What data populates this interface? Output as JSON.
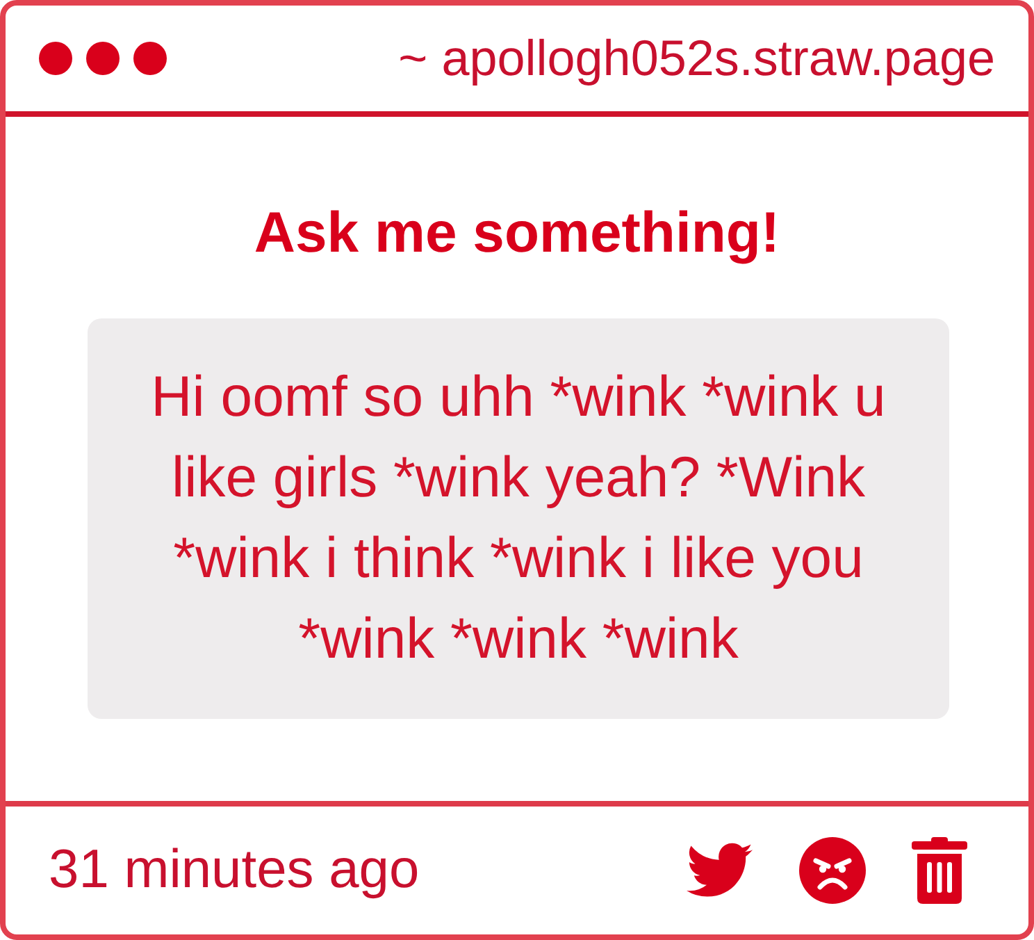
{
  "window": {
    "address": "~ apollogh052s.straw.page"
  },
  "prompt": {
    "title": "Ask me something!"
  },
  "question": {
    "text": "Hi oomf so uhh *wink *wink u like girls *wink yeah? *Wink *wink i think *wink i like you *wink *wink *wink"
  },
  "footer": {
    "time": "31 minutes ago"
  }
}
